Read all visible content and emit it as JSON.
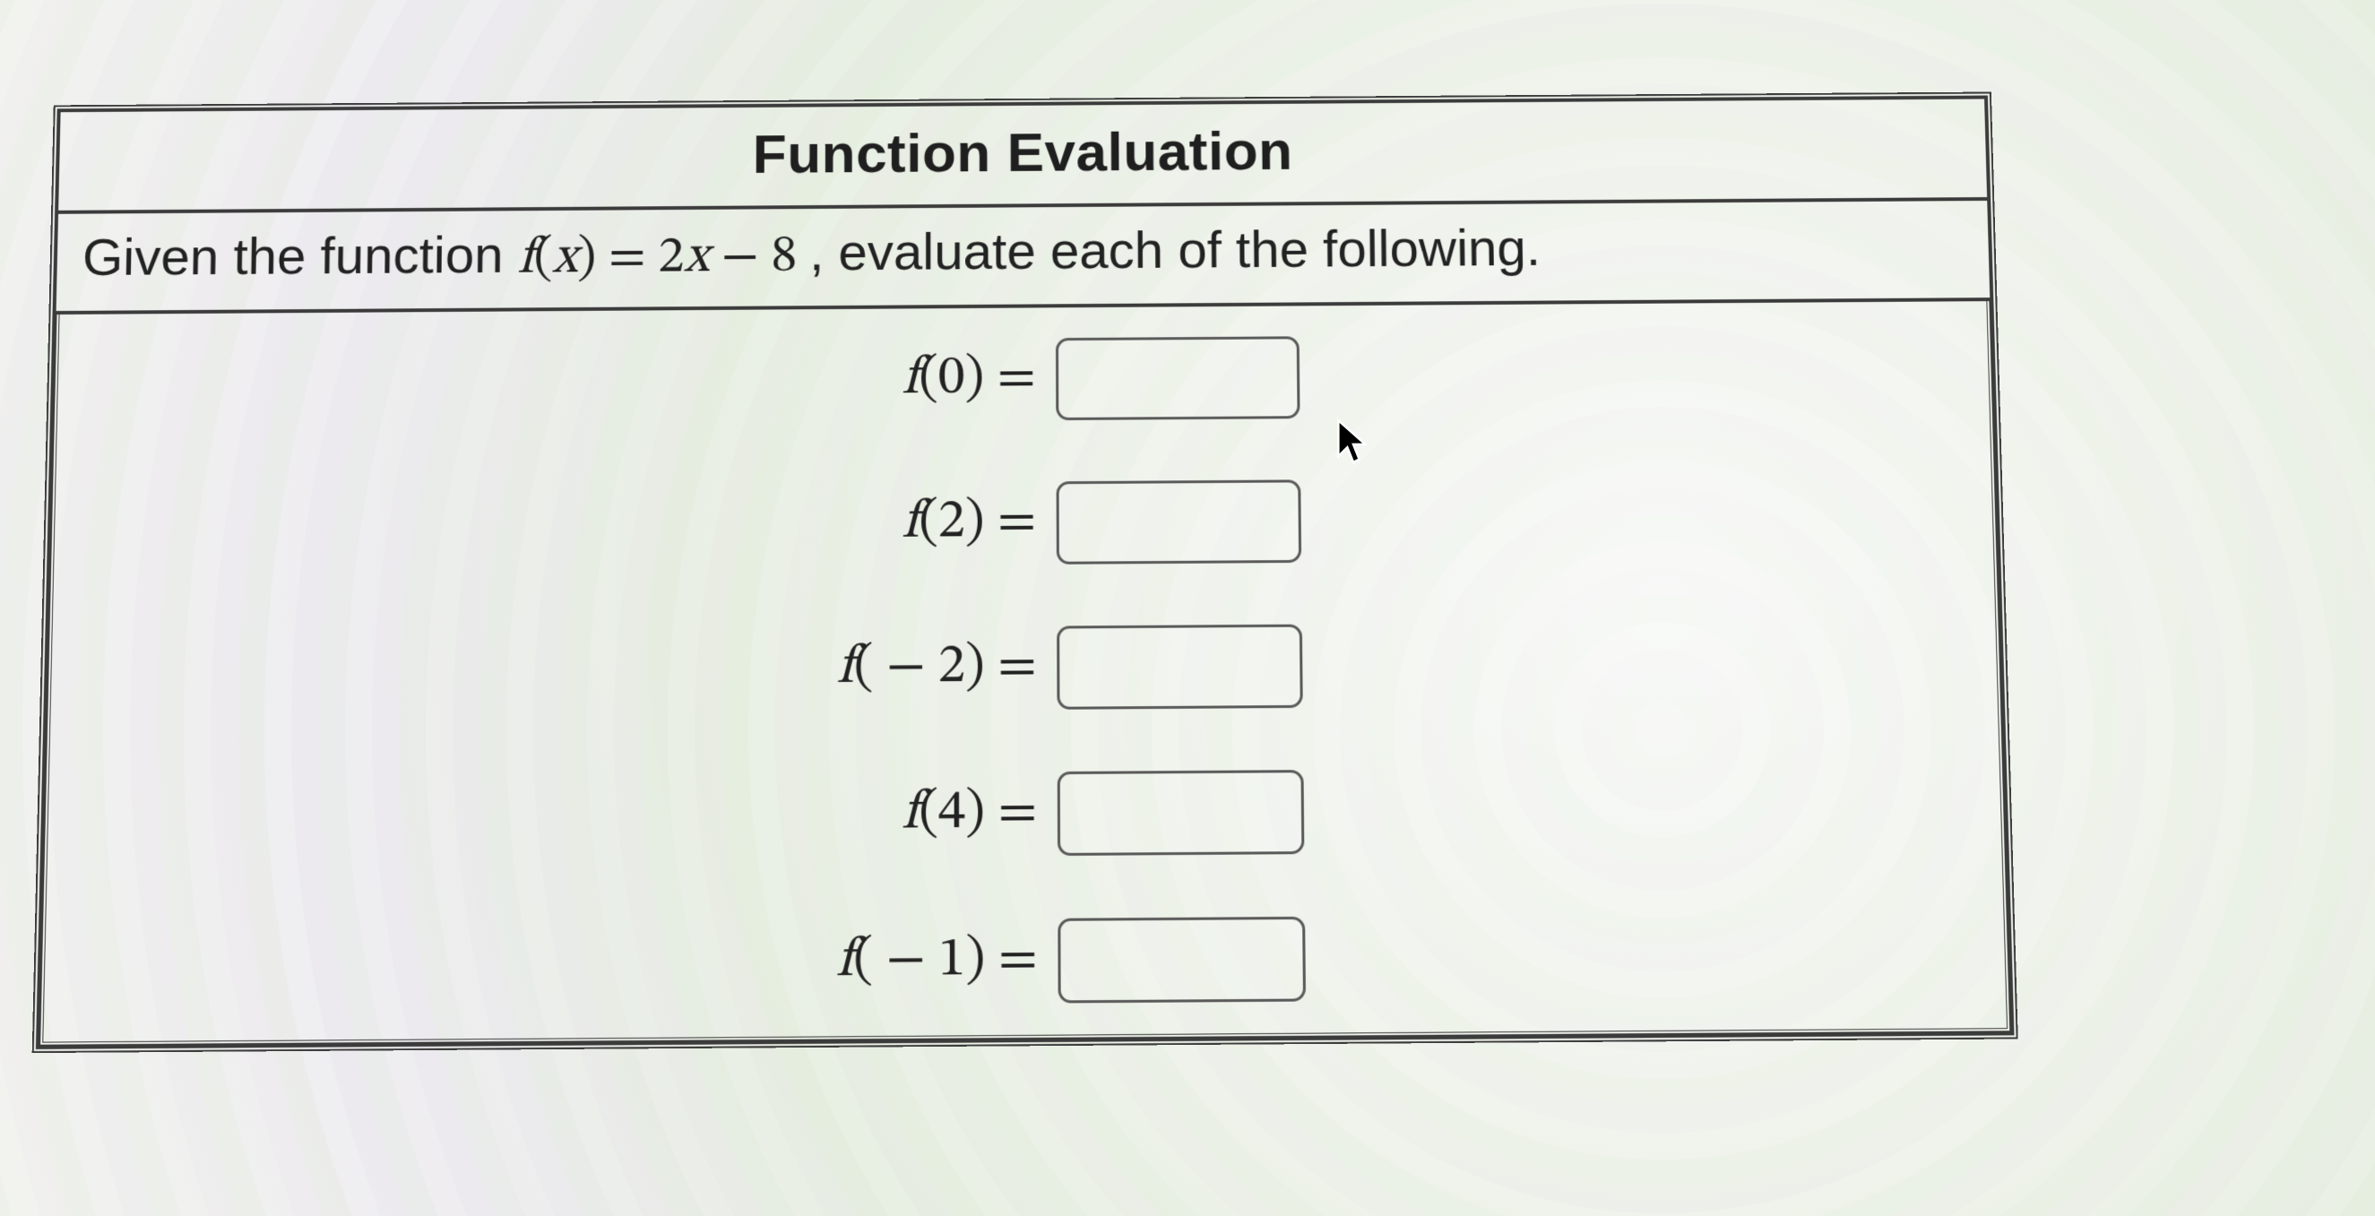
{
  "title": "Function Evaluation",
  "prompt_pre": "Given the function ",
  "prompt_func_lhs_f": "f",
  "prompt_func_lhs_open": "(",
  "prompt_func_lhs_x": "x",
  "prompt_func_lhs_close": ")",
  "prompt_eq": " = ",
  "prompt_rhs_coef": "2",
  "prompt_rhs_x": "x",
  "prompt_rhs_op": " − ",
  "prompt_rhs_const": "8",
  "prompt_post": ", evaluate each of the following.",
  "rows": [
    {
      "f": "f",
      "open": "(",
      "arg": "0",
      "close": ")",
      "eq": " = ",
      "value": ""
    },
    {
      "f": "f",
      "open": "(",
      "arg": "2",
      "close": ")",
      "eq": " = ",
      "value": ""
    },
    {
      "f": "f",
      "open": "(",
      "arg": " − 2",
      "close": ")",
      "eq": " = ",
      "value": ""
    },
    {
      "f": "f",
      "open": "(",
      "arg": "4",
      "close": ")",
      "eq": " = ",
      "value": ""
    },
    {
      "f": "f",
      "open": "(",
      "arg": " − 1",
      "close": ")",
      "eq": " = ",
      "value": ""
    }
  ]
}
